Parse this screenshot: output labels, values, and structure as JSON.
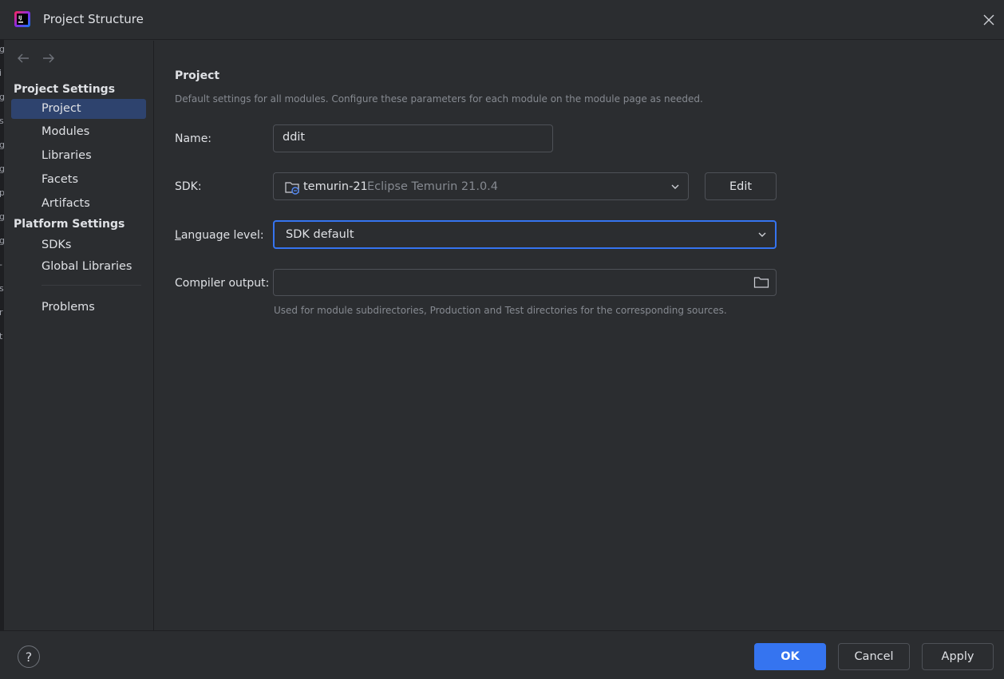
{
  "window": {
    "title": "Project Structure"
  },
  "sidebar": {
    "sections": [
      {
        "label": "Project Settings",
        "items": [
          {
            "label": "Project",
            "selected": true
          },
          {
            "label": "Modules"
          },
          {
            "label": "Libraries"
          },
          {
            "label": "Facets"
          },
          {
            "label": "Artifacts"
          }
        ]
      },
      {
        "label": "Platform Settings",
        "items": [
          {
            "label": "SDKs"
          },
          {
            "label": "Global Libraries"
          }
        ]
      }
    ],
    "problems": "Problems"
  },
  "main": {
    "heading": "Project",
    "description": "Default settings for all modules. Configure these parameters for each module on the module page as needed.",
    "name_label": "Name:",
    "name_value": "ddit",
    "sdk_label": "SDK:",
    "sdk_name": "temurin-21",
    "sdk_detail": "Eclipse Temurin 21.0.4",
    "edit_button": "Edit",
    "language_label": "Language level:",
    "language_value": "SDK default",
    "compiler_label": "Compiler output:",
    "compiler_value": "",
    "compiler_hint": "Used for module subdirectories, Production and Test directories for the corresponding sources."
  },
  "footer": {
    "help": "?",
    "ok": "OK",
    "cancel": "Cancel",
    "apply": "Apply"
  },
  "background_fragments": [
    "g",
    "i",
    "g",
    "s",
    "g",
    "g",
    "p",
    "g",
    "g",
    "-",
    "s",
    "r",
    "t"
  ],
  "colors": {
    "accent": "#3574f0",
    "selection": "#2e436e",
    "background": "#2b2d30"
  }
}
